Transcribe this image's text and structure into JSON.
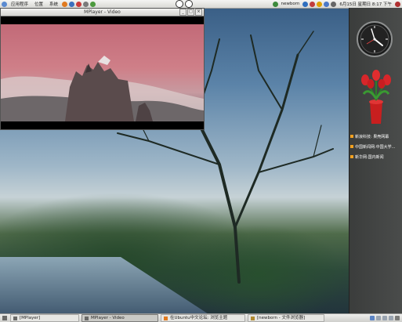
{
  "top_panel": {
    "menus": [
      {
        "label": "应用程序"
      },
      {
        "label": "位置"
      },
      {
        "label": "系统"
      }
    ],
    "user": "newborn",
    "datetime": "6月15日 星期日 8:17 下午"
  },
  "video_window": {
    "title": "MPlayer - Video",
    "buttons": [
      "_",
      "□",
      "×"
    ]
  },
  "sidebar": {
    "news": [
      {
        "label": "新浪科技: 果壳网幕"
      },
      {
        "label": "中国新闻网:中国大学..."
      },
      {
        "label": "新华网:国内新闻"
      }
    ]
  },
  "taskbar": {
    "tasks": [
      {
        "label": "[MPlayer]"
      },
      {
        "label": "MPlayer - Video"
      },
      {
        "label": "在Ubuntu中文论坛: 浏览主题"
      },
      {
        "label": "[newborn - 文件浏览器]"
      }
    ]
  },
  "colors": {
    "accent": "#f0a020",
    "panel": "#e6e6e3",
    "sidebar": "#444645"
  }
}
